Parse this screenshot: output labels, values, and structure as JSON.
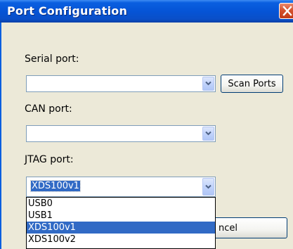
{
  "window": {
    "title": "Port Configuration"
  },
  "serial": {
    "label": "Serial port:",
    "value": "",
    "scan_label": "Scan Ports"
  },
  "can": {
    "label": "CAN port:",
    "value": ""
  },
  "jtag": {
    "label": "JTAG port:",
    "value": "XDS100v1",
    "options": [
      "USB0",
      "USB1",
      "XDS100v1",
      "XDS100v2"
    ],
    "selected_index": 2
  },
  "cancel_label": "ncel",
  "icons": {
    "close": "close-icon",
    "dropdown": "chevron-down-icon"
  }
}
